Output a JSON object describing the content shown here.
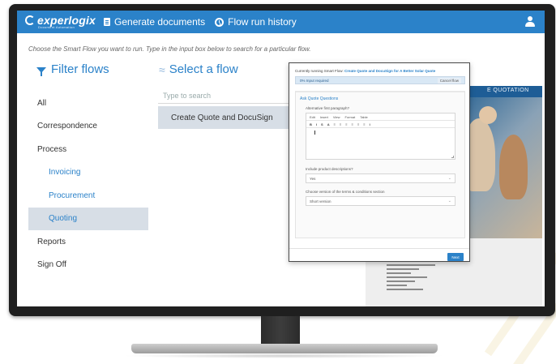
{
  "header": {
    "logo_text": "experlogix",
    "logo_subtitle": "Document Automation",
    "nav_generate": "Generate documents",
    "nav_history": "Flow run history"
  },
  "hint": "Choose the Smart Flow you want to run. Type in the input box below to search for a particular flow.",
  "filter": {
    "title": "Filter flows",
    "items": [
      {
        "label": "All"
      },
      {
        "label": "Correspondence"
      },
      {
        "label": "Process"
      },
      {
        "label": "Invoicing"
      },
      {
        "label": "Procurement"
      },
      {
        "label": "Quoting"
      },
      {
        "label": "Reports"
      },
      {
        "label": "Sign Off"
      }
    ],
    "active": "Quoting"
  },
  "select": {
    "title": "Select a flow",
    "search_placeholder": "Type to search",
    "flows": [
      "Create Quote and DocuSign"
    ]
  },
  "preview": {
    "banner": "E QUOTATION"
  },
  "modal": {
    "running_prefix": "Currently running Smart Flow:",
    "running_flow": "Create Quote and DocuSign for A Better Solar Quote",
    "progress_text": "0%   Input required",
    "progress_percent": 0,
    "cancel_label": "Cancel flow",
    "section_title": "Ask Quote Questions",
    "q1_label": "Alternative first paragraph?",
    "editor_menu": [
      "Edit",
      "Insert",
      "View",
      "Format",
      "Table"
    ],
    "editor_tools": [
      "B",
      "I",
      "S",
      "A",
      "≡",
      "≡",
      "≡",
      "≡",
      "≡",
      "≡",
      "I"
    ],
    "q2_label": "Include product descriptions?",
    "q2_value": "Yes",
    "q3_label": "Choose version of the terms & conditions section",
    "q3_value": "Short version",
    "next_label": "Next"
  },
  "colors": {
    "brand_blue": "#2b82c9",
    "active_row": "#d7dee6"
  }
}
